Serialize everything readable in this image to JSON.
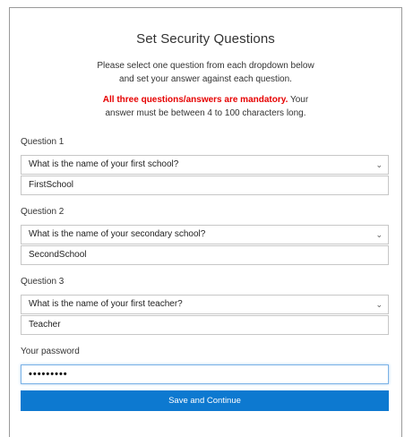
{
  "title": "Set Security Questions",
  "intro": {
    "line1": "Please select one question from each dropdown below",
    "line2": "and set your answer against each question."
  },
  "notice": {
    "mandatory": "All three questions/answers are mandatory.",
    "rest_line1": "Your",
    "rest_line2": "answer must be between 4 to 100 characters long."
  },
  "questions": [
    {
      "label": "Question 1",
      "selected": "What is the name of your first school?",
      "answer": "FirstSchool"
    },
    {
      "label": "Question 2",
      "selected": "What is the name of your secondary school?",
      "answer": "SecondSchool"
    },
    {
      "label": "Question 3",
      "selected": "What is the name of your first teacher?",
      "answer": "Teacher"
    }
  ],
  "password": {
    "label": "Your password",
    "value": "•••••••••"
  },
  "submit_label": "Save and Continue",
  "colors": {
    "accent": "#0d79d0",
    "warning": "#e60000"
  }
}
